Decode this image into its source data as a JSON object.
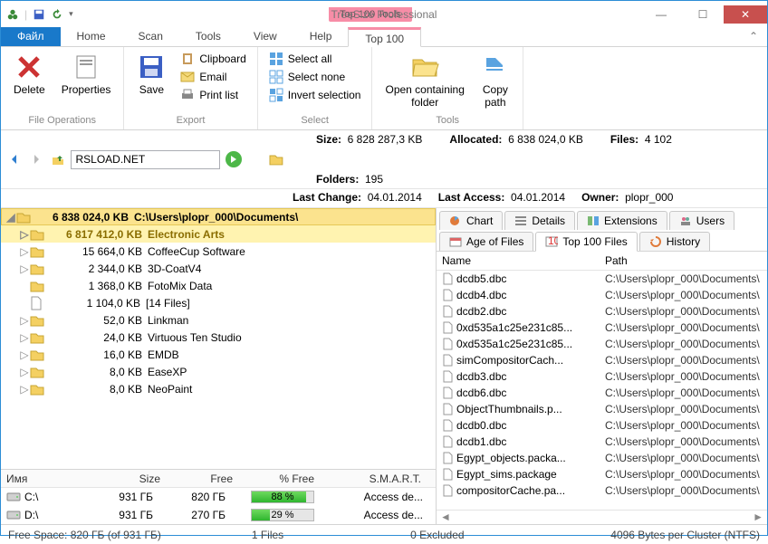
{
  "app": {
    "title": "TreeSize Professional",
    "tools_badge": "Top 100 Tools"
  },
  "tabs": {
    "file": "Файл",
    "home": "Home",
    "scan": "Scan",
    "tools": "Tools",
    "view": "View",
    "help": "Help",
    "top100": "Top 100"
  },
  "ribbon": {
    "grp_fileops": "File Operations",
    "grp_export": "Export",
    "grp_select": "Select",
    "grp_tools": "Tools",
    "delete": "Delete",
    "properties": "Properties",
    "save": "Save",
    "clipboard": "Clipboard",
    "email": "Email",
    "printlist": "Print list",
    "select_all": "Select all",
    "select_none": "Select none",
    "invert": "Invert selection",
    "open_folder": "Open containing\nfolder",
    "copy_path": "Copy\npath"
  },
  "addr": {
    "value": "RSLOAD.NET"
  },
  "info": {
    "size_lbl": "Size:",
    "size_val": "6 828 287,3 KB",
    "alloc_lbl": "Allocated:",
    "alloc_val": "6 838 024,0 KB",
    "files_lbl": "Files:",
    "files_val": "4 102",
    "folders_lbl": "Folders:",
    "folders_val": "195",
    "lastchange_lbl": "Last Change:",
    "lastchange_val": "04.01.2014",
    "lastaccess_lbl": "Last Access:",
    "lastaccess_val": "04.01.2014",
    "owner_lbl": "Owner:",
    "owner_val": "plopr_000"
  },
  "tree": {
    "root_size": "6 838 024,0 KB",
    "root_path": "C:\\Users\\plopr_000\\Documents\\",
    "rows": [
      {
        "size": "6 817 412,0 KB",
        "name": "Electronic Arts",
        "sel": true,
        "folder": true
      },
      {
        "size": "15 664,0 KB",
        "name": "CoffeeCup Software",
        "folder": true
      },
      {
        "size": "2 344,0 KB",
        "name": "3D-CoatV4",
        "folder": true
      },
      {
        "size": "1 368,0 KB",
        "name": "FotoMix Data",
        "folder": true,
        "noexp": true
      },
      {
        "size": "1 104,0 KB",
        "name": "[14 Files]",
        "file": true,
        "noexp": true
      },
      {
        "size": "52,0 KB",
        "name": "Linkman",
        "folder": true
      },
      {
        "size": "24,0 KB",
        "name": "Virtuous Ten Studio",
        "folder": true
      },
      {
        "size": "16,0 KB",
        "name": "EMDB",
        "folder": true
      },
      {
        "size": "8,0 KB",
        "name": "EaseXP",
        "folder": true
      },
      {
        "size": "8,0 KB",
        "name": "NeoPaint",
        "folder": true
      }
    ]
  },
  "drives": {
    "headers": {
      "name": "Имя",
      "size": "Size",
      "free": "Free",
      "pct": "% Free",
      "smart": "S.M.A.R.T."
    },
    "rows": [
      {
        "name": "C:\\",
        "size": "931 ГБ",
        "free": "820 ГБ",
        "pct": 88,
        "pct_txt": "88 %",
        "smart": "Access de..."
      },
      {
        "name": "D:\\",
        "size": "931 ГБ",
        "free": "270 ГБ",
        "pct": 29,
        "pct_txt": "29 %",
        "smart": "Access de..."
      }
    ]
  },
  "rtabs": {
    "chart": "Chart",
    "details": "Details",
    "ext": "Extensions",
    "users": "Users",
    "age": "Age of Files",
    "top100": "Top 100 Files",
    "history": "History"
  },
  "flist": {
    "h_name": "Name",
    "h_path": "Path",
    "rows": [
      {
        "n": "dcdb5.dbc",
        "p": "C:\\Users\\plopr_000\\Documents\\"
      },
      {
        "n": "dcdb4.dbc",
        "p": "C:\\Users\\plopr_000\\Documents\\"
      },
      {
        "n": "dcdb2.dbc",
        "p": "C:\\Users\\plopr_000\\Documents\\"
      },
      {
        "n": "0xd535a1c25e231c85...",
        "p": "C:\\Users\\plopr_000\\Documents\\"
      },
      {
        "n": "0xd535a1c25e231c85...",
        "p": "C:\\Users\\plopr_000\\Documents\\"
      },
      {
        "n": "simCompositorCach...",
        "p": "C:\\Users\\plopr_000\\Documents\\"
      },
      {
        "n": "dcdb3.dbc",
        "p": "C:\\Users\\plopr_000\\Documents\\"
      },
      {
        "n": "dcdb6.dbc",
        "p": "C:\\Users\\plopr_000\\Documents\\"
      },
      {
        "n": "ObjectThumbnails.p...",
        "p": "C:\\Users\\plopr_000\\Documents\\"
      },
      {
        "n": "dcdb0.dbc",
        "p": "C:\\Users\\plopr_000\\Documents\\"
      },
      {
        "n": "dcdb1.dbc",
        "p": "C:\\Users\\plopr_000\\Documents\\"
      },
      {
        "n": "Egypt_objects.packa...",
        "p": "C:\\Users\\plopr_000\\Documents\\"
      },
      {
        "n": "Egypt_sims.package",
        "p": "C:\\Users\\plopr_000\\Documents\\"
      },
      {
        "n": "compositorCache.pa...",
        "p": "C:\\Users\\plopr_000\\Documents\\"
      }
    ]
  },
  "status": {
    "free": "Free Space: 820 ГБ  (of 931 ГБ)",
    "files": "1  Files",
    "excluded": "0 Excluded",
    "cluster": "4096 Bytes per Cluster (NTFS)"
  }
}
